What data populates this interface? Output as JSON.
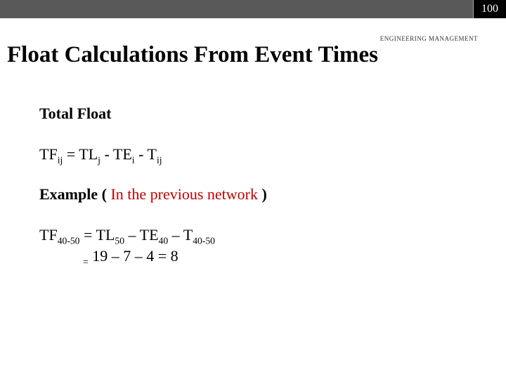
{
  "page_number": "100",
  "tagline": "ENGINEERING MANAGEMENT",
  "title": "Float Calculations From Event Times",
  "section_heading": "Total Float",
  "formula": {
    "lhs_base": "TF",
    "lhs_sub": "ij",
    "eq": " = ",
    "t1_base": "TL",
    "t1_sub": "j",
    "minus1": " - ",
    "t2_base": "TE",
    "t2_sub": "i",
    "minus2": " - ",
    "t3_base": "T",
    "t3_sub": "ij"
  },
  "example_label_pre": "Example ( ",
  "example_label_red": "In the previous network",
  "example_label_post": " )",
  "worked": {
    "lhs_base": "TF",
    "lhs_sub": "40-50",
    "eq": " = ",
    "t1_base": "TL",
    "t1_sub": "50",
    "dash1": " – ",
    "t2_base": "TE",
    "t2_sub": "40",
    "dash2": " – ",
    "t3_base": "T",
    "t3_sub": "40-50",
    "line2_eq": "=",
    "line2_rest": " 19 – 7 – 4 = 8"
  }
}
